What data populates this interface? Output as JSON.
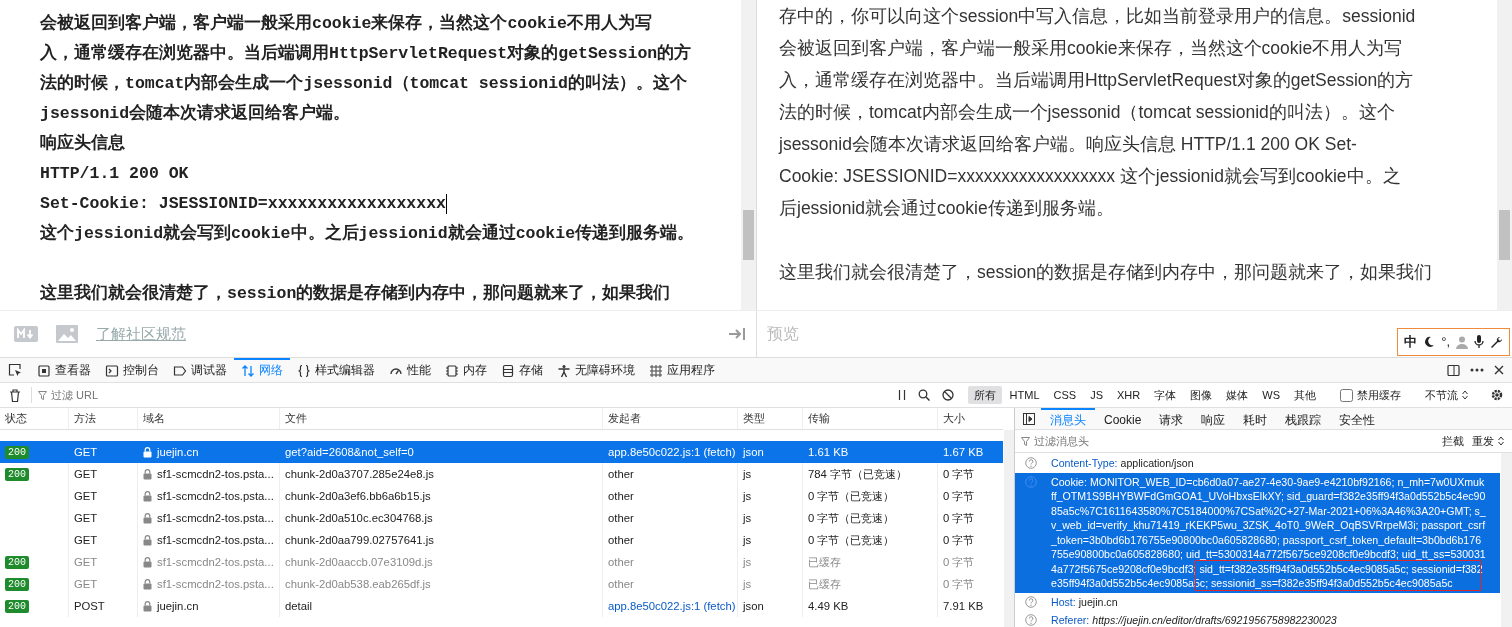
{
  "editor": {
    "lines": [
      {
        "text": "会被返回到客户端，客户端一般采用cookie来保存，当然这个cookie不用人为写",
        "space_before": false,
        "cursor": false
      },
      {
        "text": "入，通常缓存在浏览器中。当后端调用HttpServletRequest对象的getSession的方",
        "space_before": false,
        "cursor": false
      },
      {
        "text": "法的时候，tomcat内部会生成一个jsessonid（tomcat sessionid的叫法）。这个",
        "space_before": false,
        "cursor": false
      },
      {
        "text": "jsessonid会随本次请求返回给客户端。",
        "space_before": false,
        "cursor": false
      },
      {
        "text": "响应头信息",
        "space_before": false,
        "cursor": false
      },
      {
        "text": "HTTP/1.1 200 OK",
        "space_before": false,
        "cursor": false
      },
      {
        "text": "Set-Cookie: JSESSIONID=xxxxxxxxxxxxxxxxxx",
        "space_before": false,
        "cursor": true
      },
      {
        "text": "这个jessionid就会写到cookie中。之后jessionid就会通过cookie传递到服务端。",
        "space_before": false,
        "cursor": false
      },
      {
        "text": "这里我们就会很清楚了，session的数据是存储到内存中，那问题就来了，如果我们",
        "space_before": true,
        "cursor": false
      }
    ]
  },
  "preview": {
    "paragraphs": [
      {
        "lines": [
          "存中的，你可以向这个session中写入信息，比如当前登录用户的信息。sessionid",
          "会被返回到客户端，客户端一般采用cookie来保存，当然这个cookie不用人为写",
          "入，通常缓存在浏览器中。当后端调用HttpServletRequest对象的getSession的方",
          "法的时候，tomcat内部会生成一个jsessonid（tomcat sessionid的叫法）。这个",
          "jsessonid会随本次请求返回给客户端。响应头信息 HTTP/1.1 200 OK Set-",
          "Cookie: JSESSIONID=xxxxxxxxxxxxxxxxxx 这个jessionid就会写到cookie中。之",
          "后jessionid就会通过cookie传递到服务端。"
        ]
      },
      {
        "lines": [
          "这里我们就会很清楚了，session的数据是存储到内存中，那问题就来了，如果我们"
        ]
      }
    ]
  },
  "editor_toolbar": {
    "guide_link": "了解社区规范",
    "preview_label": "预览"
  },
  "ime_bar": {
    "mode": "中",
    "punctuation": "°,"
  },
  "devtools": {
    "tabs": [
      {
        "label": "查看器",
        "selected": false
      },
      {
        "label": "控制台",
        "selected": false
      },
      {
        "label": "调试器",
        "selected": false
      },
      {
        "label": "网络",
        "selected": true
      },
      {
        "label": "样式编辑器",
        "selected": false
      },
      {
        "label": "性能",
        "selected": false
      },
      {
        "label": "内存",
        "selected": false
      },
      {
        "label": "存储",
        "selected": false
      },
      {
        "label": "无障碍环境",
        "selected": false
      },
      {
        "label": "应用程序",
        "selected": false
      }
    ],
    "filter_placeholder": "过滤 URL",
    "type_filters": [
      {
        "label": "所有",
        "selected": true
      },
      {
        "label": "HTML",
        "selected": false
      },
      {
        "label": "CSS",
        "selected": false
      },
      {
        "label": "JS",
        "selected": false
      },
      {
        "label": "XHR",
        "selected": false
      },
      {
        "label": "字体",
        "selected": false
      },
      {
        "label": "图像",
        "selected": false
      },
      {
        "label": "媒体",
        "selected": false
      },
      {
        "label": "WS",
        "selected": false
      },
      {
        "label": "其他",
        "selected": false
      }
    ],
    "disable_cache": {
      "label": "禁用缓存",
      "checked": false
    },
    "throttle": "不节流",
    "table": {
      "columns": [
        "状态",
        "方法",
        "域名",
        "文件",
        "发起者",
        "类型",
        "传输",
        "大小"
      ],
      "rows": [
        {
          "status": "200",
          "method": "GET",
          "domain": "juejin.cn",
          "file": "get?aid=2608&not_self=0",
          "initiator": "app.8e50c022.js:1 (fetch)",
          "initiator_link": true,
          "type": "json",
          "transfer": "1.61 KB",
          "size": "1.67 KB",
          "selected": true,
          "cached": false
        },
        {
          "status": "200",
          "method": "GET",
          "domain": "sf1-scmcdn2-tos.psta...",
          "file": "chunk-2d0a3707.285e24e8.js",
          "initiator": "other",
          "initiator_link": false,
          "type": "js",
          "transfer": "784 字节（已竞速）",
          "size": "0 字节",
          "selected": false,
          "cached": false
        },
        {
          "method": "GET",
          "domain": "sf1-scmcdn2-tos.psta...",
          "file": "chunk-2d0a3ef6.bb6a6b15.js",
          "initiator": "other",
          "initiator_link": false,
          "type": "js",
          "transfer": "0 字节（已竞速）",
          "size": "0 字节",
          "selected": false,
          "cached": false
        },
        {
          "method": "GET",
          "domain": "sf1-scmcdn2-tos.psta...",
          "file": "chunk-2d0a510c.ec304768.js",
          "initiator": "other",
          "initiator_link": false,
          "type": "js",
          "transfer": "0 字节（已竞速）",
          "size": "0 字节",
          "selected": false,
          "cached": false
        },
        {
          "method": "GET",
          "domain": "sf1-scmcdn2-tos.psta...",
          "file": "chunk-2d0aa799.02757641.js",
          "initiator": "other",
          "initiator_link": false,
          "type": "js",
          "transfer": "0 字节（已竞速）",
          "size": "0 字节",
          "selected": false,
          "cached": false
        },
        {
          "status": "200",
          "method": "GET",
          "domain": "sf1-scmcdn2-tos.psta...",
          "file": "chunk-2d0aaccb.07e3109d.js",
          "initiator": "other",
          "initiator_link": false,
          "type": "js",
          "transfer": "已缓存",
          "size": "0 字节",
          "selected": false,
          "cached": true
        },
        {
          "status": "200",
          "method": "GET",
          "domain": "sf1-scmcdn2-tos.psta...",
          "file": "chunk-2d0ab538.eab265df.js",
          "initiator": "other",
          "initiator_link": false,
          "type": "js",
          "transfer": "已缓存",
          "size": "0 字节",
          "selected": false,
          "cached": true
        },
        {
          "status": "200",
          "method": "POST",
          "domain": "juejin.cn",
          "file": "detail",
          "initiator": "app.8e50c022.js:1 (fetch)",
          "initiator_link": true,
          "type": "json",
          "transfer": "4.49 KB",
          "size": "7.91 KB",
          "selected": false,
          "cached": false
        }
      ]
    },
    "details": {
      "tabs": [
        {
          "label": "消息头",
          "selected": true
        },
        {
          "label": "Cookie",
          "selected": false
        },
        {
          "label": "请求",
          "selected": false
        },
        {
          "label": "响应",
          "selected": false
        },
        {
          "label": "耗时",
          "selected": false
        },
        {
          "label": "栈跟踪",
          "selected": false
        },
        {
          "label": "安全性",
          "selected": false
        }
      ],
      "filter_placeholder": "过滤消息头",
      "block_label": "拦截",
      "resend_label": "重发",
      "headers": [
        {
          "name": "Content-Type:",
          "value": "application/json",
          "selected": false,
          "italic_value": false
        },
        {
          "name": "Cookie:",
          "value": "MONITOR_WEB_ID=cb6d0a07-ae27-4e30-9ae9-e4210bf92166; n_mh=7w0UXmukff_OTM1S9BHYBWFdGmGOA1_UVoHbxsElkXY; sid_guard=f382e35ff94f3a0d552b5c4ec9085a5c%7C1611643580%7C5184000%7CSat%2C+27-Mar-2021+06%3A46%3A20+GMT; s_v_web_id=verify_khu71419_rKEKP5wu_3ZSK_4oT0_9WeR_OqBSVRrpeM3i; passport_csrf_token=3b0bd6b176755e90800bc0a605828680; passport_csrf_token_default=3b0bd6b176755e90800bc0a605828680; uid_tt=5300314a772f5675ce9208cf0e9bcdf3; uid_tt_ss=5300314a772f5675ce9208cf0e9bcdf3; sid_tt=f382e35ff94f3a0d552b5c4ec9085a5c; sessionid=f382e35ff94f3a0d552b5c4ec9085a5c; sessionid_ss=f382e35ff94f3a0d552b5c4ec9085a5c",
          "selected": true,
          "italic_value": false
        },
        {
          "name": "Host:",
          "value": "juejin.cn",
          "selected": false,
          "italic_value": false
        },
        {
          "name": "Referer:",
          "value": "https://juejin.cn/editor/drafts/6921956758982230023",
          "selected": false,
          "italic_value": true
        }
      ],
      "annotation": {
        "kind": "rectangle"
      }
    }
  }
}
